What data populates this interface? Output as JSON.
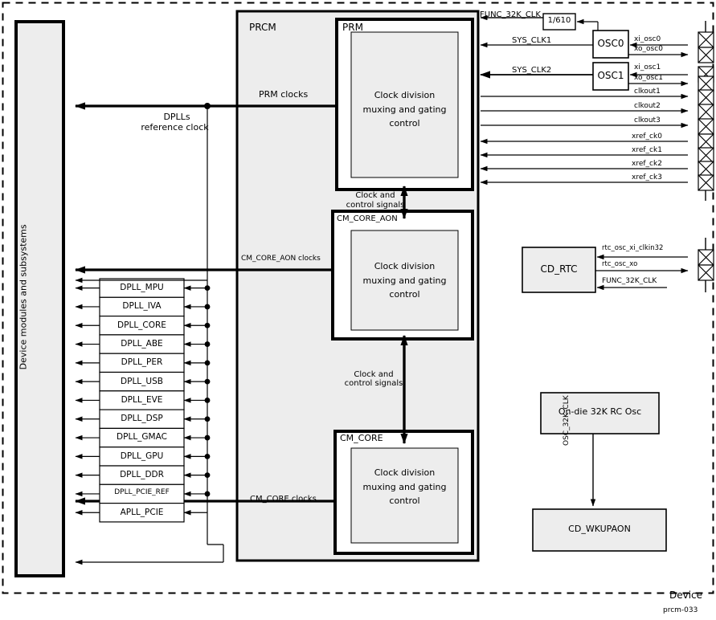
{
  "diagram": {
    "figure_id": "prcm-033",
    "device_label": "Device",
    "left_block": {
      "label": "Device modules and subsystems"
    },
    "prcm": {
      "label": "PRCM",
      "prm": {
        "label": "PRM",
        "inner_line1": "Clock division",
        "inner_line2": "muxing and gating",
        "inner_line3": "control",
        "output_label": "PRM clocks"
      },
      "cm_core_aon": {
        "label": "CM_CORE_AON",
        "inner_line1": "Clock division",
        "inner_line2": "muxing and gating",
        "inner_line3": "control",
        "output_label": "CM_CORE_AON clocks"
      },
      "cm_core": {
        "label": "CM_CORE",
        "inner_line1": "Clock division",
        "inner_line2": "muxing and gating",
        "inner_line3": "control",
        "output_label": "CM_CORE clocks"
      },
      "interconnect_top_line1": "Clock and",
      "interconnect_top_line2": "control signals",
      "interconnect_bottom_line1": "Clock and",
      "interconnect_bottom_line2": "control signals"
    },
    "dplls": {
      "reference_clock_line1": "DPLLs",
      "reference_clock_line2": "reference clock",
      "items": [
        "DPLL_MPU",
        "DPLL_IVA",
        "DPLL_CORE",
        "DPLL_ABE",
        "DPLL_PER",
        "DPLL_USB",
        "DPLL_EVE",
        "DPLL_DSP",
        "DPLL_GMAC",
        "DPLL_GPU",
        "DPLL_DDR",
        "DPLL_PCIE_REF",
        "APLL_PCIE"
      ]
    },
    "top_signals": {
      "func_32k_clk": "FUNC_32K_CLK",
      "divider": "1/610",
      "sys_clk1": "SYS_CLK1",
      "sys_clk2": "SYS_CLK2"
    },
    "oscillators": [
      {
        "label": "OSC0",
        "pin_in": "xi_osc0",
        "pin_out": "xo_osc0"
      },
      {
        "label": "OSC1",
        "pin_in": "xi_osc1",
        "pin_out": "xo_osc1"
      }
    ],
    "pad_signals": [
      "clkout1",
      "clkout2",
      "clkout3",
      "xref_ck0",
      "xref_ck1",
      "xref_ck2",
      "xref_ck3"
    ],
    "cd_rtc": {
      "label": "CD_RTC",
      "signals": [
        "rtc_osc_xi_clkin32",
        "rtc_osc_xo",
        "FUNC_32K_CLK"
      ]
    },
    "rc_osc": {
      "label": "On-die 32K RC Osc"
    },
    "wkupaon": {
      "label": "CD_WKUPAON"
    },
    "osc_32k_clk": "OSC_32K_CLK"
  },
  "colors": {
    "fill": "#ededed",
    "stroke": "#000000",
    "background": "#ffffff"
  }
}
